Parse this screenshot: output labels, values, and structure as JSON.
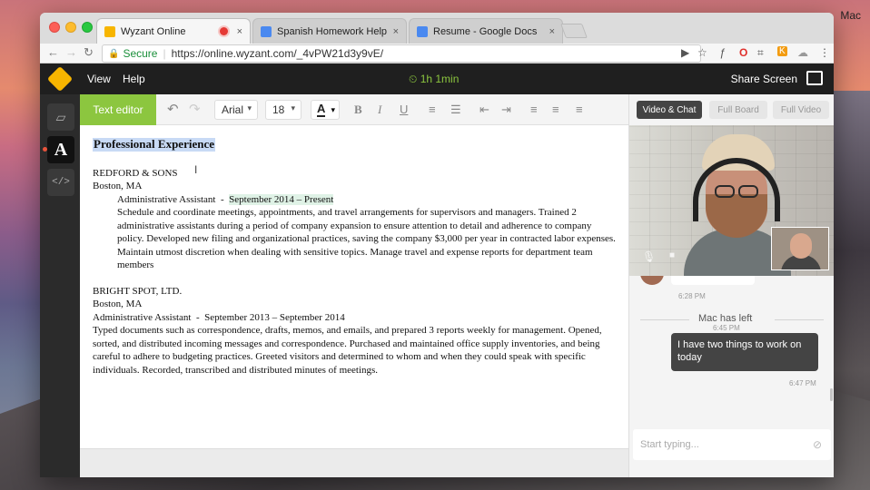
{
  "os": {
    "user_label": "Mac"
  },
  "browser": {
    "tabs": [
      {
        "title": "Wyzant Online",
        "favicon_color": "#f7b500",
        "active": true,
        "recording": true
      },
      {
        "title": "Spanish Homework Help - Goo",
        "favicon_color": "#4a89f0",
        "active": false
      },
      {
        "title": "Resume - Google Docs",
        "favicon_color": "#4a89f0",
        "active": false
      }
    ],
    "close_glyph": "×",
    "nav": {
      "back": "←",
      "forward": "→",
      "reload": "↻"
    },
    "address": {
      "lock": "🔒",
      "secure_label": "Secure",
      "separator": "|",
      "url": "https://online.wyzant.com/_4vPW21d3y9vE/"
    },
    "extensions": [
      "camera-icon",
      "star-icon",
      "function-icon",
      "opera-icon",
      "screen-icon",
      "k-icon",
      "cloud-icon",
      "more-icon"
    ],
    "ext_glyphs": [
      "▶",
      "☆",
      "ƒ",
      "O",
      "⌗",
      "K",
      "☁",
      "⋮"
    ]
  },
  "app": {
    "menu": {
      "view": "View",
      "help": "Help"
    },
    "timer": "⏲ 1h 1min",
    "share_screen": "Share Screen",
    "accent_color": "#8cc63f",
    "rail": [
      {
        "name": "whiteboard",
        "glyph": "▱"
      },
      {
        "name": "text-editor",
        "glyph": "A"
      },
      {
        "name": "code-editor",
        "glyph": "</>"
      }
    ],
    "editor_toolbar": {
      "tab_label": "Text editor",
      "undo": "↶",
      "redo": "↷",
      "font": "Arial",
      "font_caret": "▾",
      "size": "18",
      "color_letter": "A",
      "bold": "B",
      "italic": "I",
      "underline": "U",
      "bullets": "≡",
      "numbered": "☰",
      "outdent": "⇤",
      "indent": "⇥",
      "align_left": "≡",
      "align_center": "≡",
      "align_right": "≡"
    },
    "document": {
      "title": "Professional Experience",
      "cursor": "I",
      "job1": {
        "company": "REDFORD & SONS",
        "location": "Boston, MA",
        "role": "Administrative Assistant  -  ",
        "dates": "September 2014 – Present",
        "description": "Schedule and coordinate meetings, appointments, and travel arrangements for supervisors and managers. Trained 2 administrative assistants during a period of company expansion to ensure attention to detail and adherence to company policy. Developed new filing and organizational practices, saving the company $3,000 per year in contracted labor expenses. Maintain utmost discretion when dealing with sensitive topics. Manage travel and expense reports for department team members"
      },
      "job2": {
        "company": "BRIGHT SPOT, LTD.",
        "location": "Boston, MA",
        "role": "Administrative Assistant  -  September 2013 – September 2014",
        "description": "Typed documents such as correspondence, drafts, memos, and emails, and prepared 3 reports weekly for management. Opened, sorted, and distributed incoming messages and correspondence. Purchased and maintained office supply inventories, and being careful to adhere to budgeting practices. Greeted visitors and determined to whom and when they could speak with specific individuals. Recorded, transcribed and distributed minutes of meetings."
      }
    },
    "right_panel": {
      "tabs": [
        "Video & Chat",
        "Full Board",
        "Full Video"
      ],
      "mic_glyph": "🎙",
      "cam_glyph": "■",
      "chat": {
        "time1": "6:28 PM",
        "system_message": "Mac has left",
        "time2": "6:45 PM",
        "outgoing": "I have two things to work on today",
        "time3": "6:47 PM",
        "placeholder": "Start typing...",
        "attach_glyph": "⊘"
      }
    }
  }
}
